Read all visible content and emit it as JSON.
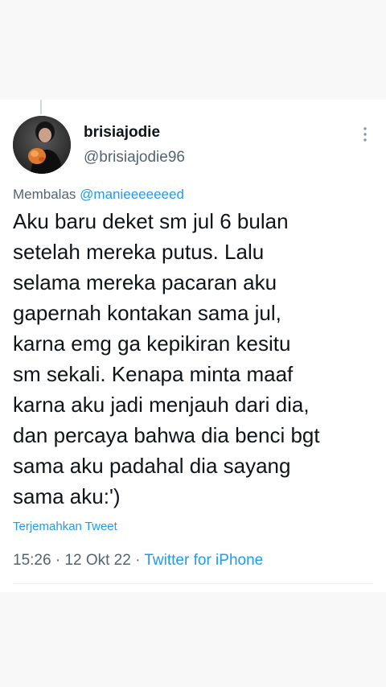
{
  "tweet": {
    "display_name": "brisiajodie",
    "handle": "@brisiajodie96",
    "reply_prefix": "Membalas",
    "reply_to": "@manieeeeeeed",
    "text": "Aku baru deket sm jul 6 bulan\nsetelah mereka putus. Lalu\nselama mereka pacaran aku\ngapernah kontakan sama jul,\nkarna emg ga kepikiran kesitu\nsm sekali. Kenapa minta maaf\nkarna aku jadi menjauh dari dia,\ndan percaya bahwa dia benci bgt\nsama aku padahal dia sayang\nsama aku:')",
    "translate_label": "Terjemahkan Tweet",
    "time": "15:26",
    "separator_1": "·",
    "date": "12 Okt 22",
    "separator_2": "·",
    "source": "Twitter for iPhone"
  },
  "icons": {
    "more": "more-vertical-icon",
    "avatar": "avatar"
  },
  "colors": {
    "text_primary": "#0f1419",
    "text_secondary": "#536471",
    "link_blue": "#1d9bf0",
    "background": "#f8f8f8",
    "card": "#ffffff"
  }
}
